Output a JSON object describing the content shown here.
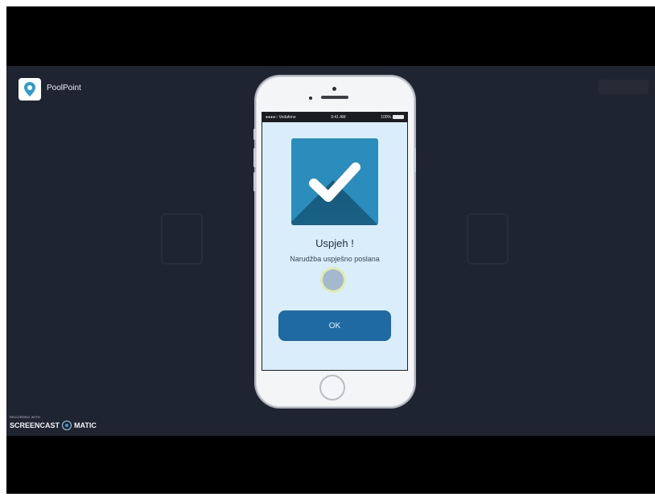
{
  "app": {
    "name": "PoolPoint",
    "logo_icon": "map-pin-icon"
  },
  "phone": {
    "status_bar": {
      "carrier": "●●●●○ Vodafone",
      "time": "9:41 AM",
      "battery": "100%"
    },
    "dialog": {
      "icon": "checkmark-icon",
      "title": "Uspjeh !",
      "message": "Narudžba uspješno poslana",
      "ok_label": "OK"
    }
  },
  "watermark": {
    "line1": "RECORDED WITH",
    "brand_a": "SCREENCAST",
    "brand_b": "MATIC"
  },
  "colors": {
    "background": "#1f2530",
    "tile": "#2b8dbb",
    "ok_button": "#1f6aa3",
    "screen": "#d9eefa"
  }
}
